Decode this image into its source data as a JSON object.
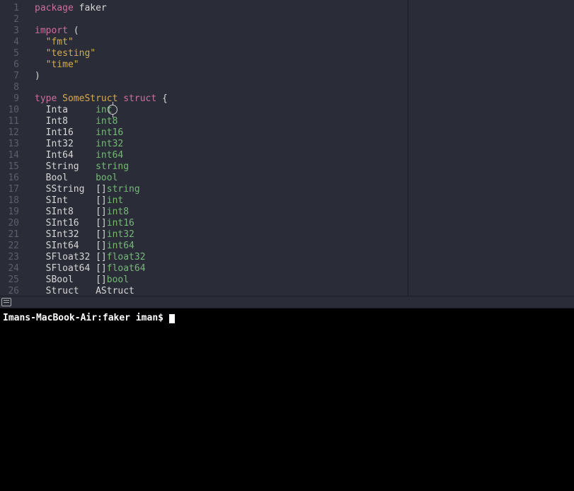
{
  "editor": {
    "lines": [
      {
        "num": 1,
        "tokens": [
          {
            "t": "package ",
            "c": "kw-pkg"
          },
          {
            "t": "faker",
            "c": "pkg-name"
          }
        ]
      },
      {
        "num": 2,
        "tokens": []
      },
      {
        "num": 3,
        "tokens": [
          {
            "t": "import ",
            "c": "kw-import"
          },
          {
            "t": "(",
            "c": "punct"
          }
        ]
      },
      {
        "num": 4,
        "tokens": [
          {
            "t": "  ",
            "c": "punct"
          },
          {
            "t": "\"fmt\"",
            "c": "string-lit"
          }
        ]
      },
      {
        "num": 5,
        "tokens": [
          {
            "t": "  ",
            "c": "punct"
          },
          {
            "t": "\"testing\"",
            "c": "string-lit"
          }
        ]
      },
      {
        "num": 6,
        "tokens": [
          {
            "t": "  ",
            "c": "punct"
          },
          {
            "t": "\"time\"",
            "c": "string-lit"
          }
        ]
      },
      {
        "num": 7,
        "tokens": [
          {
            "t": ")",
            "c": "punct"
          }
        ]
      },
      {
        "num": 8,
        "tokens": []
      },
      {
        "num": 9,
        "tokens": [
          {
            "t": "type ",
            "c": "kw-type"
          },
          {
            "t": "SomeStruct ",
            "c": "type-name"
          },
          {
            "t": "struct ",
            "c": "kw-struct"
          },
          {
            "t": "{",
            "c": "punct"
          }
        ]
      },
      {
        "num": 10,
        "tokens": [
          {
            "t": "  Inta     ",
            "c": "field-name"
          },
          {
            "t": "int",
            "c": "builtin-type"
          }
        ]
      },
      {
        "num": 11,
        "tokens": [
          {
            "t": "  Int8     ",
            "c": "field-name"
          },
          {
            "t": "int8",
            "c": "builtin-type"
          }
        ]
      },
      {
        "num": 12,
        "tokens": [
          {
            "t": "  Int16    ",
            "c": "field-name"
          },
          {
            "t": "int16",
            "c": "builtin-type"
          }
        ]
      },
      {
        "num": 13,
        "tokens": [
          {
            "t": "  Int32    ",
            "c": "field-name"
          },
          {
            "t": "int32",
            "c": "builtin-type"
          }
        ]
      },
      {
        "num": 14,
        "tokens": [
          {
            "t": "  Int64    ",
            "c": "field-name"
          },
          {
            "t": "int64",
            "c": "builtin-type"
          }
        ]
      },
      {
        "num": 15,
        "tokens": [
          {
            "t": "  String   ",
            "c": "field-name"
          },
          {
            "t": "string",
            "c": "builtin-type"
          }
        ]
      },
      {
        "num": 16,
        "tokens": [
          {
            "t": "  Bool     ",
            "c": "field-name"
          },
          {
            "t": "bool",
            "c": "builtin-type"
          }
        ]
      },
      {
        "num": 17,
        "tokens": [
          {
            "t": "  SString  ",
            "c": "field-name"
          },
          {
            "t": "[]",
            "c": "slice-bracket"
          },
          {
            "t": "string",
            "c": "builtin-type"
          }
        ]
      },
      {
        "num": 18,
        "tokens": [
          {
            "t": "  SInt     ",
            "c": "field-name"
          },
          {
            "t": "[]",
            "c": "slice-bracket"
          },
          {
            "t": "int",
            "c": "builtin-type"
          }
        ]
      },
      {
        "num": 19,
        "tokens": [
          {
            "t": "  SInt8    ",
            "c": "field-name"
          },
          {
            "t": "[]",
            "c": "slice-bracket"
          },
          {
            "t": "int8",
            "c": "builtin-type"
          }
        ]
      },
      {
        "num": 20,
        "tokens": [
          {
            "t": "  SInt16   ",
            "c": "field-name"
          },
          {
            "t": "[]",
            "c": "slice-bracket"
          },
          {
            "t": "int16",
            "c": "builtin-type"
          }
        ]
      },
      {
        "num": 21,
        "tokens": [
          {
            "t": "  SInt32   ",
            "c": "field-name"
          },
          {
            "t": "[]",
            "c": "slice-bracket"
          },
          {
            "t": "int32",
            "c": "builtin-type"
          }
        ]
      },
      {
        "num": 22,
        "tokens": [
          {
            "t": "  SInt64   ",
            "c": "field-name"
          },
          {
            "t": "[]",
            "c": "slice-bracket"
          },
          {
            "t": "int64",
            "c": "builtin-type"
          }
        ]
      },
      {
        "num": 23,
        "tokens": [
          {
            "t": "  SFloat32 ",
            "c": "field-name"
          },
          {
            "t": "[]",
            "c": "slice-bracket"
          },
          {
            "t": "float32",
            "c": "builtin-type"
          }
        ]
      },
      {
        "num": 24,
        "tokens": [
          {
            "t": "  SFloat64 ",
            "c": "field-name"
          },
          {
            "t": "[]",
            "c": "slice-bracket"
          },
          {
            "t": "float64",
            "c": "builtin-type"
          }
        ]
      },
      {
        "num": 25,
        "tokens": [
          {
            "t": "  SBool    ",
            "c": "field-name"
          },
          {
            "t": "[]",
            "c": "slice-bracket"
          },
          {
            "t": "bool",
            "c": "builtin-type"
          }
        ]
      },
      {
        "num": 26,
        "tokens": [
          {
            "t": "  Struct   AStruct",
            "c": "field-name"
          }
        ]
      }
    ]
  },
  "terminal": {
    "prompt": "Imans-MacBook-Air:faker iman$ "
  }
}
